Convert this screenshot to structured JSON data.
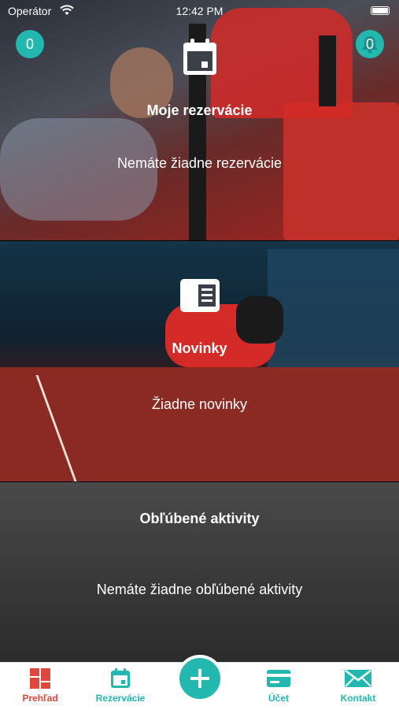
{
  "status_bar": {
    "carrier": "Operátor",
    "time": "12:42 PM"
  },
  "badges": {
    "left_count": "0",
    "right_count": "0"
  },
  "reservations": {
    "title": "Moje rezervácie",
    "empty_text": "Nemáte žiadne rezervácie",
    "icon": "calendar-icon"
  },
  "news": {
    "title": "Novinky",
    "empty_text": "Žiadne novinky",
    "icon": "newspaper-icon"
  },
  "favorites": {
    "title": "Obľúbené aktivity",
    "empty_text": "Nemáte žiadne obľúbené aktivity"
  },
  "tabbar": {
    "items": [
      {
        "label": "Prehľad",
        "icon": "dashboard-icon",
        "active": true
      },
      {
        "label": "Rezervácie",
        "icon": "calendar-icon",
        "active": false
      },
      {
        "label": "",
        "icon": "plus-icon",
        "active": false
      },
      {
        "label": "Účet",
        "icon": "card-icon",
        "active": false
      },
      {
        "label": "Kontakt",
        "icon": "envelope-icon",
        "active": false
      }
    ]
  },
  "colors": {
    "accent": "#22b8b0",
    "active": "#e0483e"
  }
}
